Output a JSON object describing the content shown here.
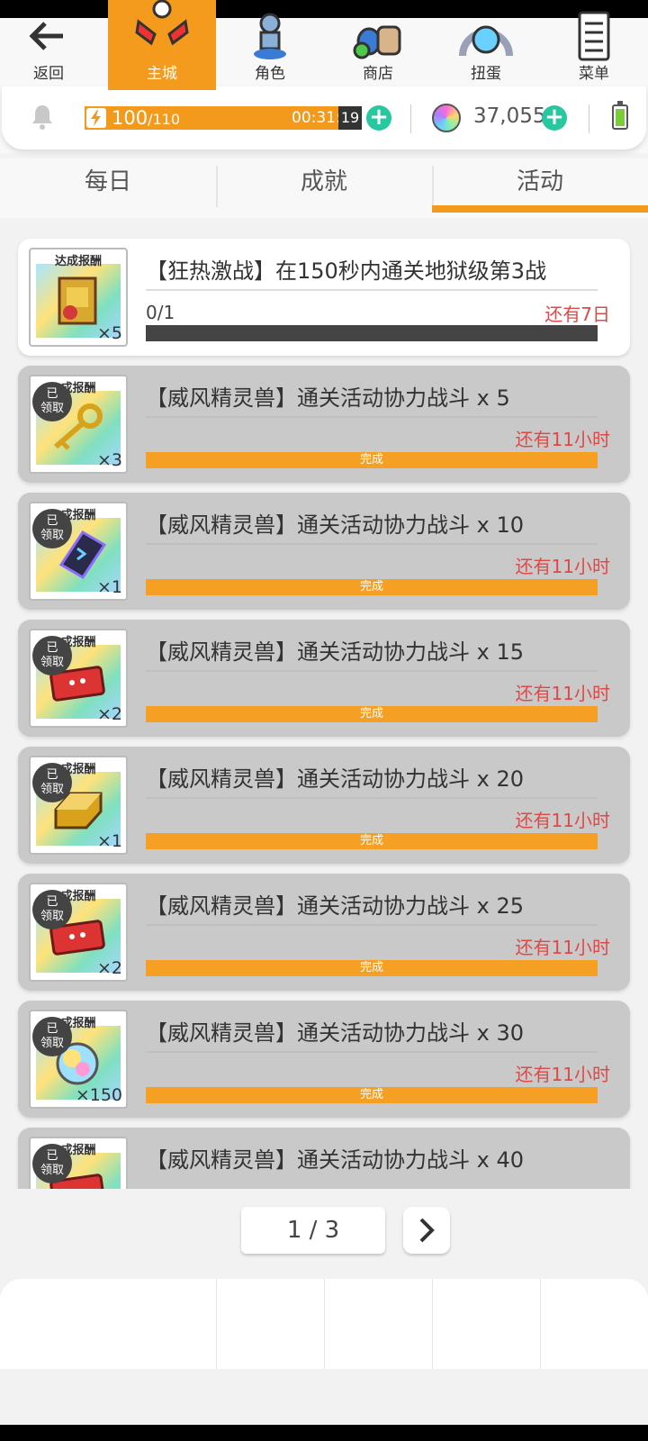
{
  "header": {
    "stamina_current": "100",
    "stamina_max": "/110",
    "timer_main": "00:31:",
    "timer_sec": "19",
    "gems": "37,055"
  },
  "tabs": [
    {
      "label": "每日"
    },
    {
      "label": "成就"
    },
    {
      "label": "活动"
    }
  ],
  "active_tab": "活动",
  "reward_header": "达成报酬",
  "reward_header_short": "成报酬",
  "claimed_badge": "已\n领取",
  "claimed_line1": "已",
  "claimed_line2": "领取",
  "done_label": "完成",
  "missions": [
    {
      "title": "【狂热激战】在150秒内通关地狱级第3战",
      "progress": "0/1",
      "remaining": "还有7日",
      "qty": "×5",
      "done": false
    },
    {
      "title": "【威风精灵兽】通关活动协力战斗 x 5",
      "remaining": "还有11小时",
      "qty": "×3",
      "done": true
    },
    {
      "title": "【威风精灵兽】通关活动协力战斗 x 10",
      "remaining": "还有11小时",
      "qty": "×1",
      "done": true
    },
    {
      "title": "【威风精灵兽】通关活动协力战斗 x 15",
      "remaining": "还有11小时",
      "qty": "×2",
      "done": true
    },
    {
      "title": "【威风精灵兽】通关活动协力战斗 x 20",
      "remaining": "还有11小时",
      "qty": "×1",
      "done": true
    },
    {
      "title": "【威风精灵兽】通关活动协力战斗 x 25",
      "remaining": "还有11小时",
      "qty": "×2",
      "done": true
    },
    {
      "title": "【威风精灵兽】通关活动协力战斗 x 30",
      "remaining": "还有11小时",
      "qty": "×150",
      "done": true
    },
    {
      "title": "【威风精灵兽】通关活动协力战斗 x 40",
      "remaining": "",
      "qty": "",
      "done": true
    }
  ],
  "pagination": {
    "label": "1 / 3"
  },
  "bottom_nav": [
    {
      "label": "返回",
      "icon": "back-arrow-icon"
    },
    {
      "label": "主城",
      "icon": "castle-wings-icon"
    },
    {
      "label": "角色",
      "icon": "character-icon"
    },
    {
      "label": "商店",
      "icon": "shop-bag-icon"
    },
    {
      "label": "扭蛋",
      "icon": "gacha-icon"
    },
    {
      "label": "菜单",
      "icon": "menu-list-icon"
    }
  ],
  "colors": {
    "accent": "#f39a1c",
    "plus": "#27c7a0",
    "remain_red": "#e04848",
    "card_done_bg": "#c9c9c9"
  }
}
